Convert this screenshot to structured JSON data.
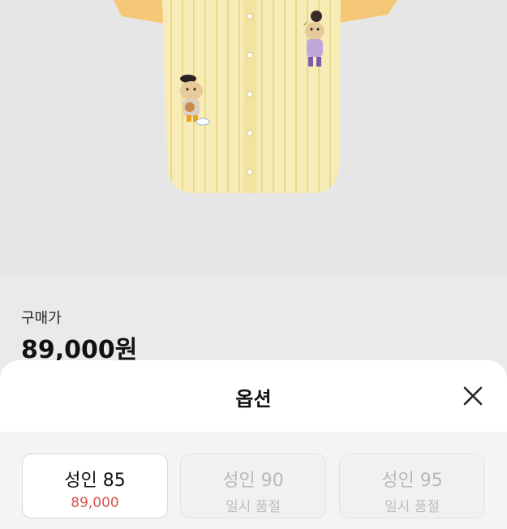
{
  "product": {
    "image_icon": "yellow-striped-baseball-jersey",
    "price_label": "구매가",
    "price": "89,000원"
  },
  "sheet": {
    "title": "옵션",
    "close_icon": "close-icon",
    "options": [
      {
        "name": "성인 85",
        "sub": "89,000",
        "status": "available"
      },
      {
        "name": "성인 90",
        "sub": "일시 품절",
        "status": "soldout"
      },
      {
        "name": "성인 95",
        "sub": "일시 품절",
        "status": "soldout"
      }
    ]
  },
  "colors": {
    "price_accent": "#d9534f",
    "jersey": "#f6eab0",
    "sleeve": "#f4c877"
  }
}
